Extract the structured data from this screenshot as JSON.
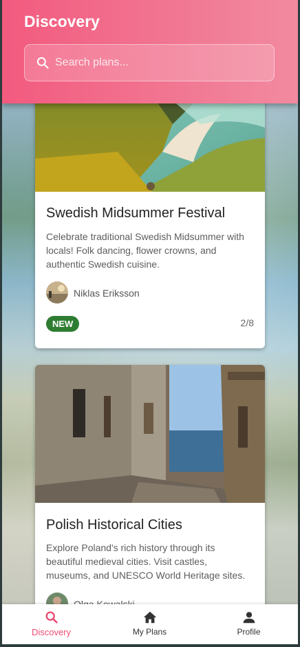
{
  "header": {
    "title": "Discovery",
    "search_placeholder": "Search plans..."
  },
  "plans": [
    {
      "title": "Swedish Midsummer Festival",
      "description": "Celebrate traditional Swedish Midsummer with locals! Folk dancing, flower crowns, and authentic Swedish cuisine.",
      "author": "Niklas Eriksson",
      "badge": "NEW",
      "count": "2/8"
    },
    {
      "title": "Polish Historical Cities",
      "description": "Explore Poland's rich history through its beautiful medieval cities. Visit castles, museums, and UNESCO World Heritage sites.",
      "author": "Olga Kowalski"
    }
  ],
  "bottom_nav": {
    "items": [
      {
        "label": "Discovery",
        "icon": "search-icon",
        "active": true
      },
      {
        "label": "My Plans",
        "icon": "home-icon",
        "active": false
      },
      {
        "label": "Profile",
        "icon": "person-icon",
        "active": false
      }
    ]
  },
  "colors": {
    "accent": "#ee4c74",
    "badge_green": "#2e7d32",
    "header_gradient_start": "#f25a7e",
    "header_gradient_end": "#f28aa0"
  }
}
